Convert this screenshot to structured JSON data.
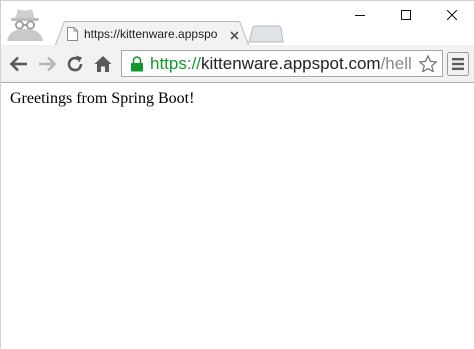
{
  "tab": {
    "title": "https://kittenware.appspo",
    "icon": "document-icon"
  },
  "address_bar": {
    "scheme": "https://",
    "host": "kittenware.appspot.com",
    "path": "/hello"
  },
  "page": {
    "text": "Greetings from Spring Boot!"
  },
  "colors": {
    "secure_scheme": "#119a2b",
    "toolbar": "#f2f2f2",
    "tab_border": "#b4b8bf"
  },
  "icons": [
    "incognito-icon",
    "document-icon",
    "close-icon",
    "minimize-icon",
    "maximize-icon",
    "back-arrow-icon",
    "forward-arrow-icon",
    "reload-icon",
    "home-icon",
    "lock-icon",
    "star-icon",
    "menu-icon"
  ]
}
